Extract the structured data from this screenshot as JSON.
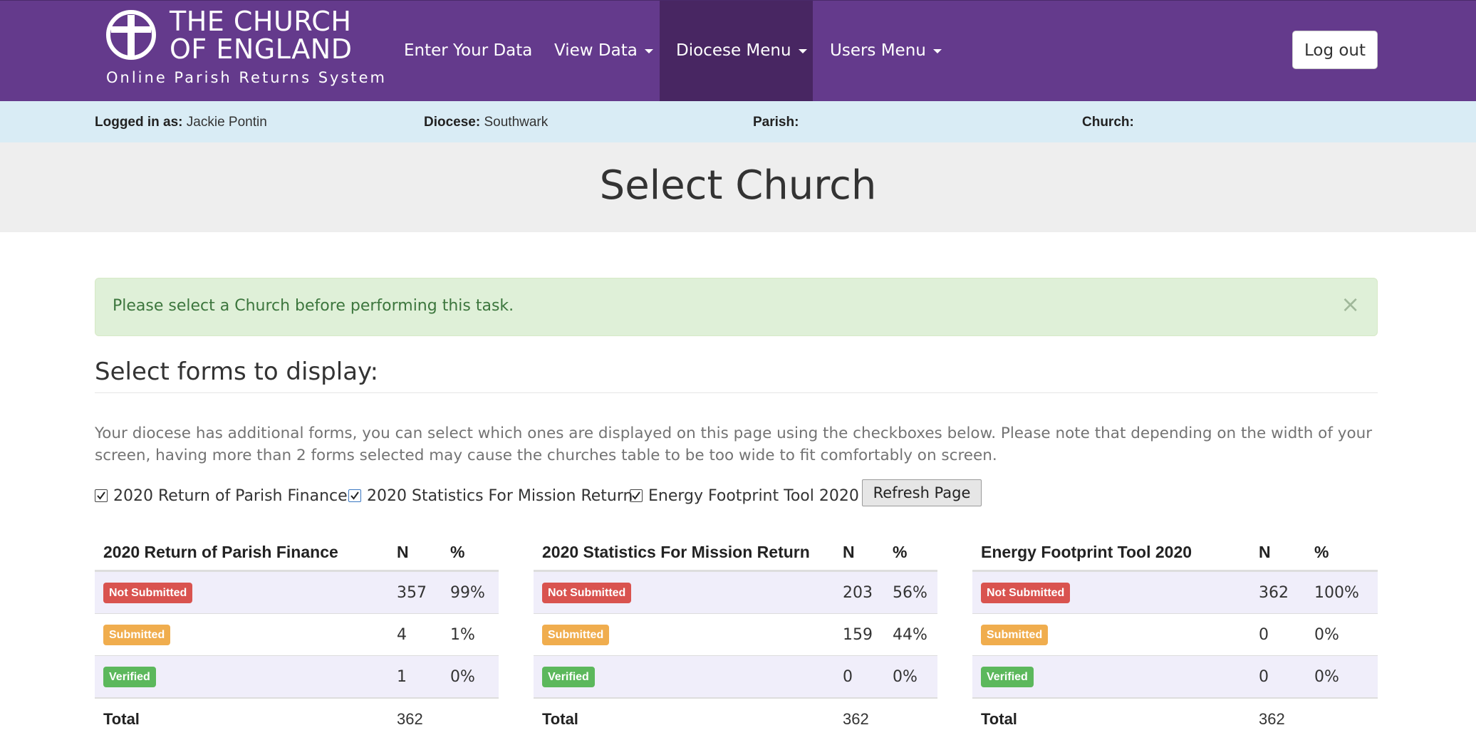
{
  "brand": {
    "title": "THE CHURCH\nOF ENGLAND",
    "subtitle": "Online Parish Returns System",
    "logo_icon": "cross-circle-icon"
  },
  "nav": {
    "items": [
      {
        "label": "Enter Your Data",
        "dropdown": false,
        "active": false
      },
      {
        "label": "View Data",
        "dropdown": true,
        "active": false
      },
      {
        "label": "Diocese Menu",
        "dropdown": true,
        "active": true
      },
      {
        "label": "Users Menu",
        "dropdown": true,
        "active": false
      }
    ],
    "logout_label": "Log out"
  },
  "info": {
    "logged_in_label": "Logged in as:",
    "logged_in_value": "Jackie Pontin",
    "diocese_label": "Diocese:",
    "diocese_value": "Southwark",
    "parish_label": "Parish:",
    "parish_value": "",
    "church_label": "Church:",
    "church_value": ""
  },
  "page": {
    "title": "Select Church"
  },
  "alert": {
    "message": "Please select a Church before performing this task.",
    "close_label": "×"
  },
  "forms_section": {
    "heading": "Select forms to display:",
    "description": "Your diocese has additional forms, you can select which ones are displayed on this page using the checkboxes below. Please note that depending on the width of your screen, having more than 2 forms selected may cause the churches table to be too wide to fit comfortably on screen.",
    "checkboxes": [
      {
        "label": "2020 Return of Parish Finance",
        "checked": true
      },
      {
        "label": "2020 Statistics For Mission Return",
        "checked": true
      },
      {
        "label": "Energy Footprint Tool 2020",
        "checked": true
      }
    ],
    "refresh_label": "Refresh Page"
  },
  "colors": {
    "navbar": "#643a8c",
    "nav_active": "#482662",
    "info_bar": "#d9ecf5",
    "not_submitted": "#d9534f",
    "submitted": "#f0ad4e",
    "verified": "#5cb85c"
  },
  "tables": [
    {
      "title": "2020 Return of Parish Finance",
      "col_n": "N",
      "col_pct": "%",
      "rows": [
        {
          "status": "Not Submitted",
          "n": "357",
          "pct": "99%"
        },
        {
          "status": "Submitted",
          "n": "4",
          "pct": "1%"
        },
        {
          "status": "Verified",
          "n": "1",
          "pct": "0%"
        }
      ],
      "total_label": "Total",
      "total_n": "362"
    },
    {
      "title": "2020 Statistics For Mission Return",
      "col_n": "N",
      "col_pct": "%",
      "rows": [
        {
          "status": "Not Submitted",
          "n": "203",
          "pct": "56%"
        },
        {
          "status": "Submitted",
          "n": "159",
          "pct": "44%"
        },
        {
          "status": "Verified",
          "n": "0",
          "pct": "0%"
        }
      ],
      "total_label": "Total",
      "total_n": "362"
    },
    {
      "title": "Energy Footprint Tool 2020",
      "col_n": "N",
      "col_pct": "%",
      "rows": [
        {
          "status": "Not Submitted",
          "n": "362",
          "pct": "100%"
        },
        {
          "status": "Submitted",
          "n": "0",
          "pct": "0%"
        },
        {
          "status": "Verified",
          "n": "0",
          "pct": "0%"
        }
      ],
      "total_label": "Total",
      "total_n": "362"
    }
  ]
}
